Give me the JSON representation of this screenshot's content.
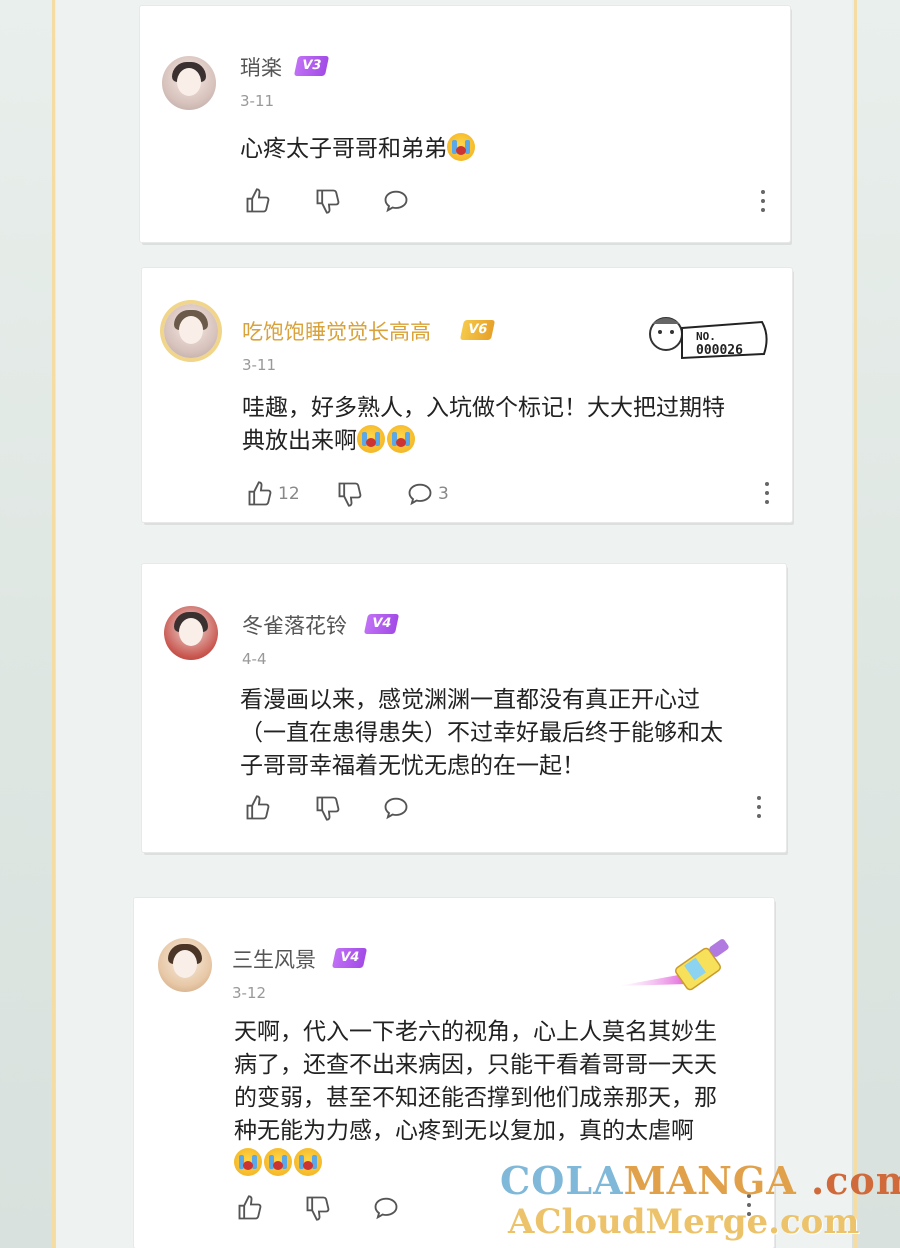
{
  "comments": [
    {
      "username": "琑楽",
      "level": "V3",
      "date": "3-11",
      "text_lines": [
        "心疼太子哥哥和弟弟"
      ],
      "likes": "",
      "replies": ""
    },
    {
      "username": "吃饱饱睡觉觉长高高",
      "level": "V6",
      "date": "3-11",
      "text_lines": [
        "哇趣，好多熟人，入坑做个标记！大大把过期特",
        "典放出来啊"
      ],
      "likes": "12",
      "replies": "3",
      "stamp": {
        "label": "NO.",
        "number": "000026"
      }
    },
    {
      "username": "冬雀落花铃",
      "level": "V4",
      "date": "4-4",
      "text_lines": [
        "看漫画以来，感觉渊渊一直都没有真正开心过",
        "（一直在患得患失）不过幸好最后终于能够和太",
        "子哥哥幸福着无忧无虑的在一起！"
      ],
      "likes": "",
      "replies": ""
    },
    {
      "username": "三生风景",
      "level": "V4",
      "date": "3-12",
      "text_lines": [
        "天啊，代入一下老六的视角，心上人莫名其妙生",
        "病了，还查不出来病因，只能干看着哥哥一天天",
        "的变弱，甚至不知还能否撑到他们成亲那天，那",
        "种无能为力感，心疼到无以复加，真的太虐啊"
      ],
      "likes": "",
      "replies": ""
    }
  ],
  "watermark": {
    "line1_a": "COLA",
    "line1_b": "MANGA",
    "line1_c": ".com",
    "line2": "ACloudMerge.com"
  },
  "colors": {
    "frame": "#f4dca3",
    "badge_purple": "#b25cf0",
    "badge_gold": "#eab23a",
    "gold_name": "#d9a23a"
  }
}
